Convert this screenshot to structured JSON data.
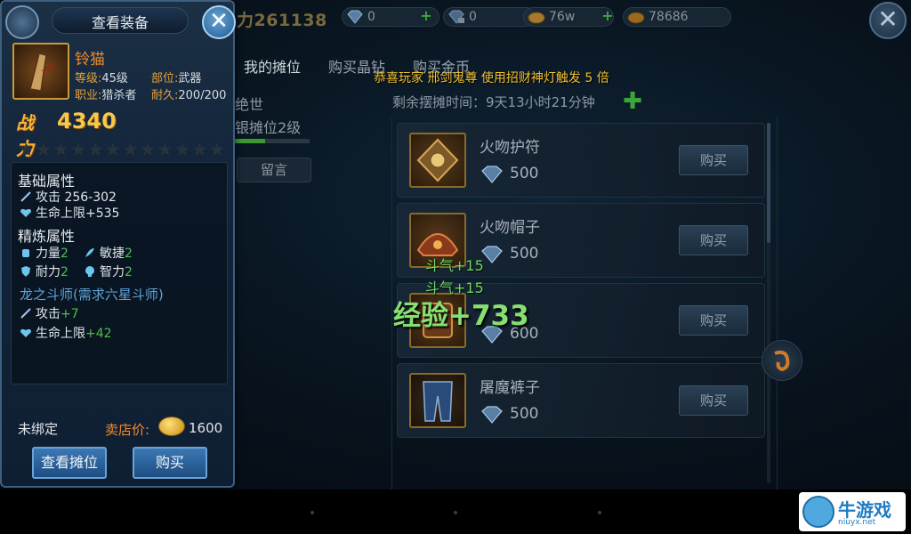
{
  "top_bar": {
    "power_display": "力261138",
    "diamond": "0",
    "bound_diamond": "0",
    "gold": "76w",
    "silver": "78686",
    "close_glyph": "✕"
  },
  "tabs": [
    "我的摊位",
    "购买晶钻",
    "购买金币"
  ],
  "notice": "恭喜玩家 邢剑鬼尊 使用招财神灯触发 5 倍",
  "left_partial": {
    "line1": "绝世",
    "line2": "银摊位2级",
    "message_button": "留言"
  },
  "timer": "剩余摆摊时间：9天13小时21分钟",
  "timer_plus": "✚",
  "shop_items": [
    {
      "name": "火吻护符",
      "price": "500",
      "buy": "购买"
    },
    {
      "name": "火吻帽子",
      "price": "500",
      "buy": "购买"
    },
    {
      "name": "",
      "price": "600",
      "buy": "购买"
    },
    {
      "name": "屠魔裤子",
      "price": "500",
      "buy": "购买"
    }
  ],
  "floating": {
    "line1": "斗气+15",
    "line2": "斗气+15",
    "exp": "经验+733"
  },
  "equip": {
    "title": "查看装备",
    "close_glyph": "✕",
    "item_name": "铃猫",
    "level_label": "等级:",
    "level_value": "45级",
    "slot_label": "部位:",
    "slot_value": "武器",
    "class_label": "职业:",
    "class_value": "猎杀者",
    "durability_label": "耐久:",
    "durability_value": "200/200",
    "power_glyph": "战力",
    "power_value": "4340",
    "stars_total": 12,
    "base_title": "基础属性",
    "base_attrs": [
      {
        "label": "攻击",
        "value": "256-302",
        "icon": "sword-icon"
      },
      {
        "label": "生命上限",
        "value": "+535",
        "icon": "heart-icon"
      }
    ],
    "refine_title": "精炼属性",
    "refine_attrs": [
      {
        "label": "力量",
        "value": "2",
        "icon": "fist-icon"
      },
      {
        "label": "敏捷",
        "value": "2",
        "icon": "feather-icon"
      },
      {
        "label": "耐力",
        "value": "2",
        "icon": "shield-icon"
      },
      {
        "label": "智力",
        "value": "2",
        "icon": "brain-icon"
      }
    ],
    "set_title": "龙之斗师(需求六星斗师)",
    "set_attrs": [
      {
        "label": "攻击",
        "value": "+7",
        "icon": "sword-icon"
      },
      {
        "label": "生命上限",
        "value": "+42",
        "icon": "heart-icon"
      }
    ],
    "bind_status": "未绑定",
    "sell_label": "卖店价:",
    "sell_price": "1600",
    "btn_view_stall": "查看摊位",
    "btn_buy": "购买"
  },
  "watermark": {
    "text": "牛游戏",
    "sub": "niuyx.net"
  },
  "colors": {
    "gold_accent": "#f8c84a",
    "orange_text": "#f08a2a",
    "green_bonus": "#4fc04a",
    "notice_yellow": "#f2c230",
    "panel_border": "#3d5f80"
  }
}
